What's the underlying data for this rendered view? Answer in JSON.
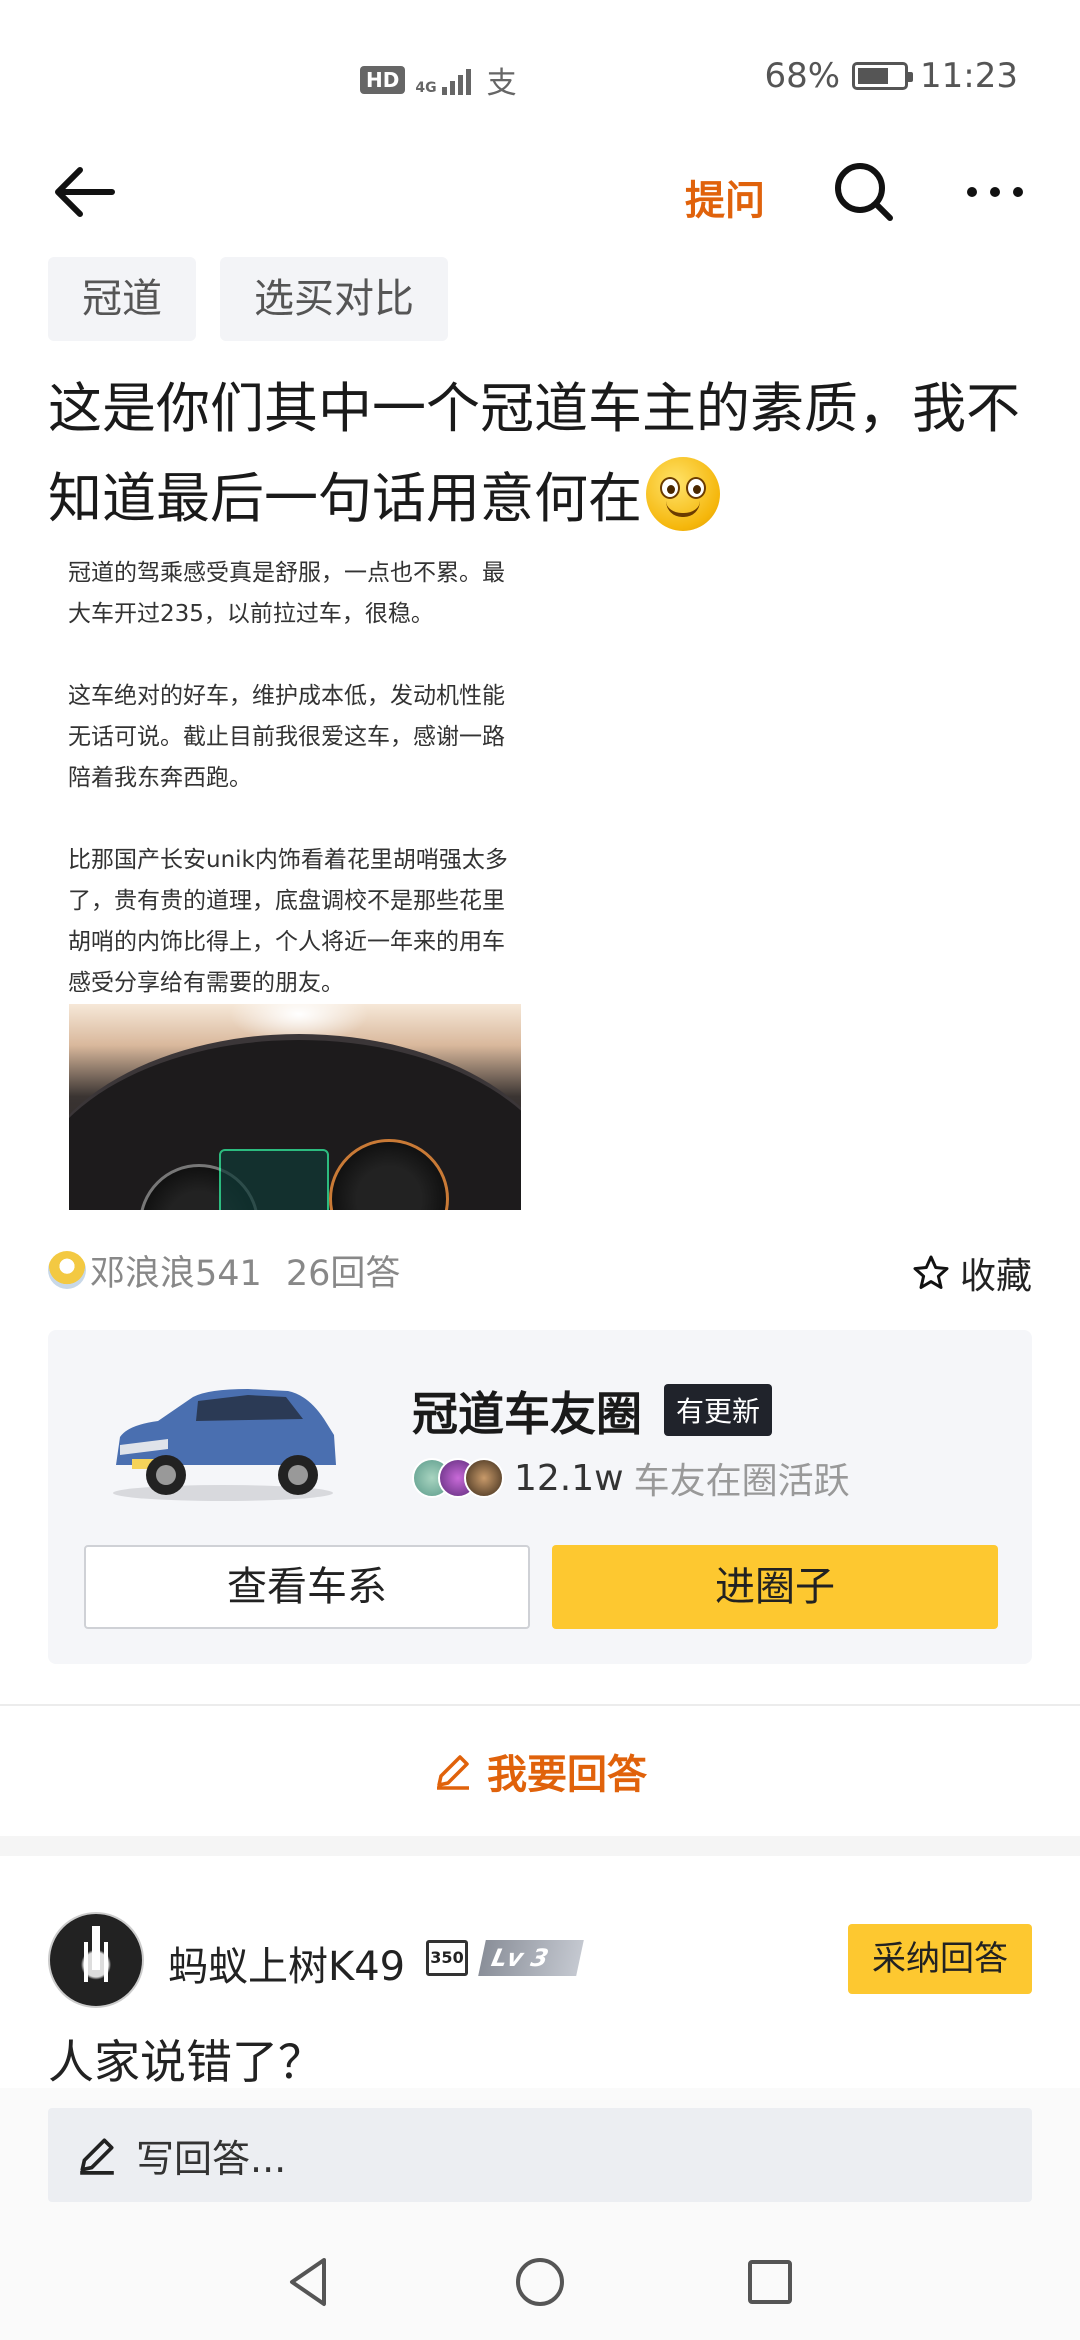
{
  "status_bar": {
    "hd": "HD",
    "network": "4G",
    "battery": "68%",
    "battery_level": 0.68,
    "time": "11:23"
  },
  "header": {
    "ask_label": "提问",
    "icons": [
      "back-arrow-icon",
      "search-icon",
      "more-icon"
    ]
  },
  "tags": [
    "冠道",
    "选买对比"
  ],
  "title": {
    "line1": "这是你们其中一个冠道车主的素质，我不",
    "line2": "知道最后一句话用意何在"
  },
  "post_image": {
    "paragraphs": [
      "冠道的驾乘感受真是舒服，一点也不累。最大车开过235，以前拉过车，很稳。",
      "这车绝对的好车，维护成本低，发动机性能无话可说。截止目前我很爱这车，感谢一路陪着我东奔西跑。",
      "比那国产长安unik内饰看着花里胡哨强太多了，贵有贵的道理，底盘调校不是那些花里胡哨的内饰比得上，个人将近一年来的用车感受分享给有需要的朋友。"
    ]
  },
  "meta": {
    "author": "邓浪浪541",
    "answers": "26回答",
    "favorite_label": "收藏"
  },
  "circle": {
    "name": "冠道车友圈",
    "badge": "有更新",
    "member_count": "12.1w",
    "member_desc": "车友在圈活跃",
    "view_label": "查看车系",
    "join_label": "进圈子",
    "colors": {
      "join": "#fdc830",
      "badge_bg": "#20232b"
    }
  },
  "answer_cta": "我要回答",
  "answer": {
    "user": "蚂蚁上树K49",
    "badge_350": "350",
    "level": "Lv 3",
    "adopt_label": "采纳回答",
    "text": "人家说错了？"
  },
  "write_placeholder": "写回答...",
  "accent_color": "#e0620b"
}
